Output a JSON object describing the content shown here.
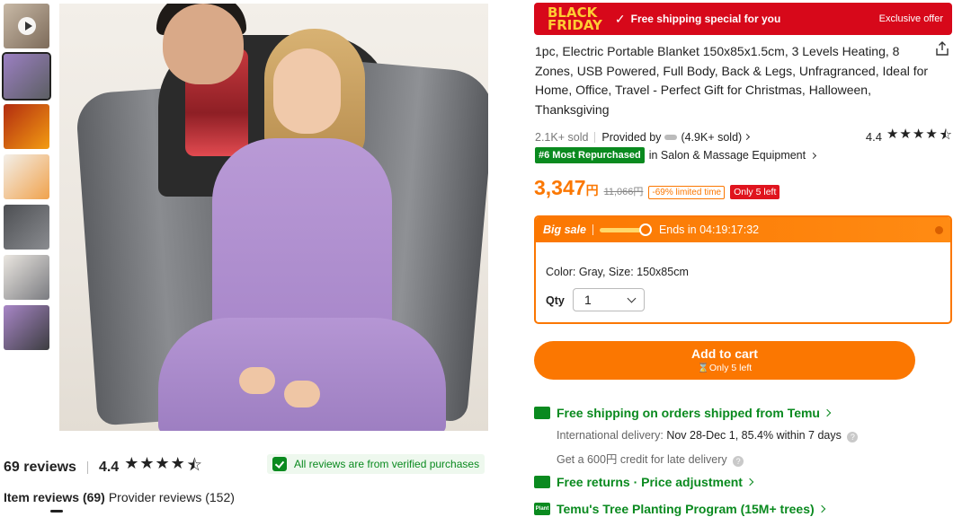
{
  "banner": {
    "logo_line1": "BLACK",
    "logo_line2": "FRIDAY",
    "check": "✓",
    "shipping_text": "Free shipping special for you",
    "exclusive": "Exclusive offer"
  },
  "product": {
    "title": "1pc, Electric Portable Blanket 150x85x1.5cm, 3 Levels Heating, 8 Zones, USB Powered, Full Body, Back & Legs, Unfragranced, Ideal for Home, Office, Travel - Perfect Gift for Christmas, Halloween, Thanksgiving",
    "sold": "2.1K+ sold",
    "provided_by": "Provided by",
    "provider_sold": "(4.9K+ sold)",
    "rating": "4.4",
    "rank_badge": "#6 Most Repurchased",
    "rank_category": "in Salon & Massage Equipment",
    "price": "3,347",
    "currency": "円",
    "old_price": "11,066円",
    "discount": "-69% limited time",
    "stock_badge": "Only 5 left"
  },
  "sale": {
    "label": "Big sale",
    "countdown": "Ends in 04:19:17:32",
    "variant": "Color: Gray, Size: 150x85cm",
    "qty_label": "Qty",
    "qty_value": "1"
  },
  "cart": {
    "label": "Add to cart",
    "sub": "⌛Only 5 left"
  },
  "services": {
    "shipping_title": "Free shipping on orders shipped from Temu",
    "intl_label": "International delivery:",
    "intl_value": "Nov 28-Dec 1, 85.4% within 7 days",
    "credit": "Get a 600円 credit for late delivery",
    "returns": "Free returns · Price adjustment",
    "plant_icon": "Plant",
    "tree": "Temu's Tree Planting Program (15M+ trees)"
  },
  "reviews": {
    "count": "69 reviews",
    "rating": "4.4",
    "verified": "All reviews are from verified purchases",
    "tab_item": "Item reviews (69)",
    "tab_provider": "Provider reviews (152)"
  },
  "icons": {
    "stars_full": "★★★★",
    "star_half": "⯪"
  },
  "colors": {
    "accent": "#fb7701",
    "green": "#0a8a1f",
    "red": "#d7081a"
  }
}
